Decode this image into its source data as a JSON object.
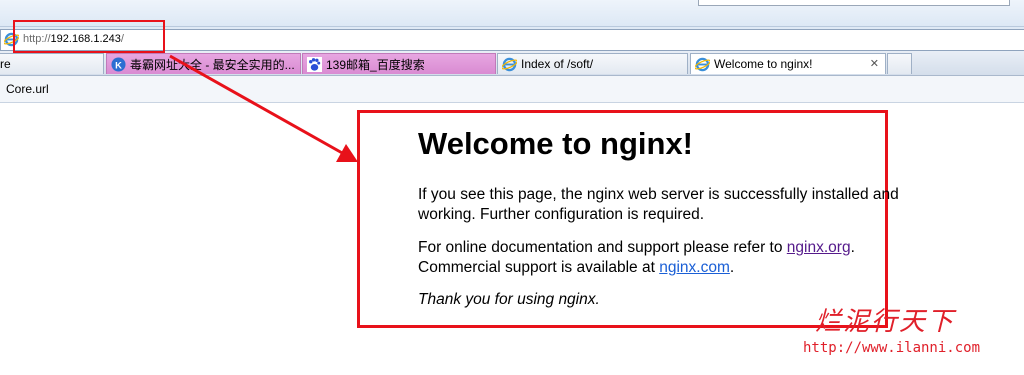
{
  "address": {
    "prefix": "http://",
    "host": "192.168.1.243",
    "suffix": "/"
  },
  "tabs": [
    {
      "label": "re",
      "icon": "none"
    },
    {
      "label": "毒霸网址大全 - 最安全实用的...",
      "icon": "k-logo-icon"
    },
    {
      "label": "139邮箱_百度搜索",
      "icon": "baidu-paw-icon"
    },
    {
      "label": "Index of /soft/",
      "icon": "ie-icon"
    },
    {
      "label": "Welcome to nginx!",
      "icon": "ie-icon",
      "close": "✕"
    }
  ],
  "favorites": {
    "item": "Core.url"
  },
  "page": {
    "title": "Welcome to nginx!",
    "p1": "If you see this page, the nginx web server is successfully installed and working. Further configuration is required.",
    "p2_before": "For online documentation and support please refer to ",
    "link_org": "nginx.org",
    "p2_mid": ".\nCommercial support is available at ",
    "link_com": "nginx.com",
    "p2_end": ".",
    "p3": "Thank you for using nginx."
  },
  "watermark": {
    "brand": "烂泥行天下",
    "url": "http://www.ilanni.com"
  },
  "colors": {
    "highlight": "#e8111a",
    "visited_link": "#551a8b",
    "link": "#1a5fd6"
  }
}
